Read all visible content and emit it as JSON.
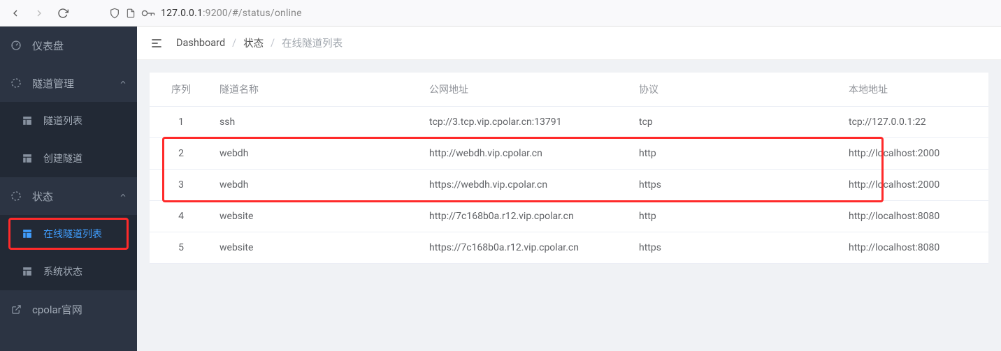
{
  "browser": {
    "url_host": "127.0.0.1",
    "url_port": ":9200",
    "url_path": "/#/status/online"
  },
  "sidebar": {
    "items": [
      {
        "label": "仪表盘",
        "icon": "dashboard-icon",
        "kind": "parent",
        "expandable": false
      },
      {
        "label": "隧道管理",
        "icon": "loader-icon",
        "kind": "parent",
        "expandable": true
      },
      {
        "label": "隧道列表",
        "icon": "grid-icon",
        "kind": "child"
      },
      {
        "label": "创建隧道",
        "icon": "grid-icon",
        "kind": "child"
      },
      {
        "label": "状态",
        "icon": "loader-icon",
        "kind": "parent",
        "expandable": true
      },
      {
        "label": "在线隧道列表",
        "icon": "grid-icon",
        "kind": "child",
        "active": true
      },
      {
        "label": "系统状态",
        "icon": "grid-icon",
        "kind": "child"
      },
      {
        "label": "cpolar官网",
        "icon": "external-icon",
        "kind": "parent",
        "expandable": false
      }
    ]
  },
  "breadcrumb": {
    "items": [
      "Dashboard",
      "状态",
      "在线隧道列表"
    ]
  },
  "table": {
    "headers": [
      "序列",
      "隧道名称",
      "公网地址",
      "协议",
      "本地地址"
    ],
    "rows": [
      {
        "seq": "1",
        "name": "ssh",
        "public": "tcp://3.tcp.vip.cpolar.cn:13791",
        "proto": "tcp",
        "local": "tcp://127.0.0.1:22"
      },
      {
        "seq": "2",
        "name": "webdh",
        "public": "http://webdh.vip.cpolar.cn",
        "proto": "http",
        "local": "http://localhost:2000"
      },
      {
        "seq": "3",
        "name": "webdh",
        "public": "https://webdh.vip.cpolar.cn",
        "proto": "https",
        "local": "http://localhost:2000"
      },
      {
        "seq": "4",
        "name": "website",
        "public": "http://7c168b0a.r12.vip.cpolar.cn",
        "proto": "http",
        "local": "http://localhost:8080"
      },
      {
        "seq": "5",
        "name": "website",
        "public": "https://7c168b0a.r12.vip.cpolar.cn",
        "proto": "https",
        "local": "http://localhost:8080"
      }
    ]
  },
  "highlights": {
    "sidebar_active_index": 5,
    "table_rows_boxed": [
      1,
      2
    ]
  }
}
